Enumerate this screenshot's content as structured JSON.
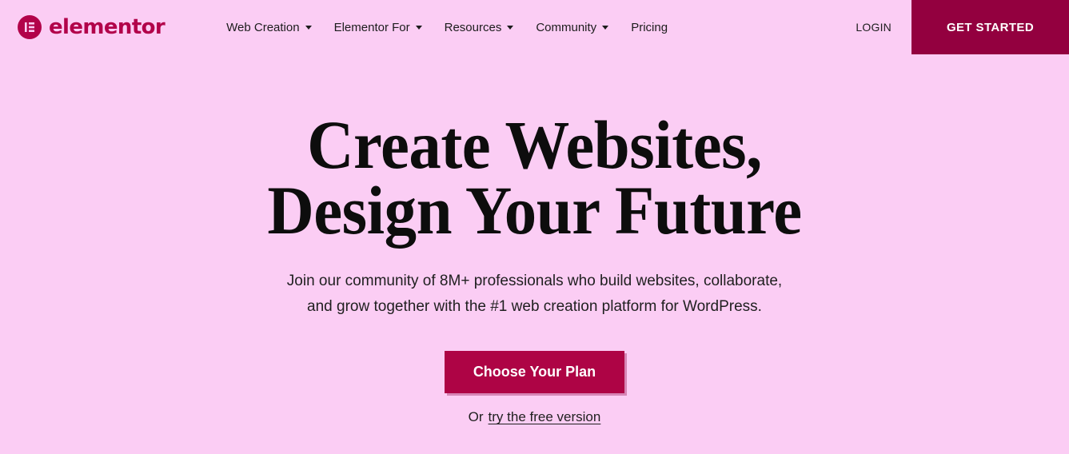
{
  "theme": {
    "page_background": "#fbcdf4",
    "brand_accent": "#b2024a",
    "cta_primary": "#ae0445",
    "cta_header": "#93003f",
    "text_primary": "#1c1c1c",
    "heading_color": "#0d0d0d"
  },
  "header": {
    "brand": {
      "logo_icon": "elementor-logo-icon",
      "name": "elementor"
    },
    "nav": [
      {
        "label": "Web Creation",
        "has_dropdown": true,
        "caret_icon": "chevron-down-icon"
      },
      {
        "label": "Elementor For",
        "has_dropdown": true,
        "caret_icon": "chevron-down-icon"
      },
      {
        "label": "Resources",
        "has_dropdown": true,
        "caret_icon": "chevron-down-icon"
      },
      {
        "label": "Community",
        "has_dropdown": true,
        "caret_icon": "chevron-down-icon"
      },
      {
        "label": "Pricing",
        "has_dropdown": false,
        "caret_icon": ""
      }
    ],
    "login_label": "LOGIN",
    "get_started_label": "GET STARTED"
  },
  "hero": {
    "title_line_1": "Create Websites,",
    "title_line_2": "Design Your Future",
    "subtitle_line_1": "Join our community of 8M+ professionals who build websites, collaborate,",
    "subtitle_line_2": "and grow together with the #1 web creation platform for WordPress.",
    "primary_cta_label": "Choose Your Plan",
    "secondary_prefix": "Or",
    "secondary_link_label": "try the free version"
  }
}
